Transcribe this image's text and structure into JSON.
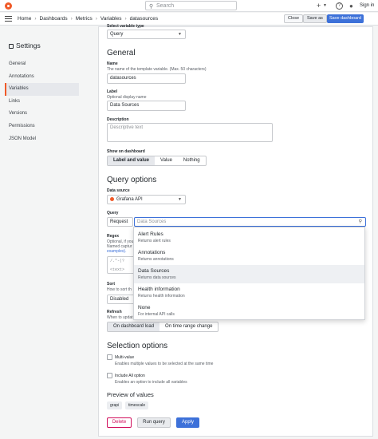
{
  "topbar": {
    "search_placeholder": "Search",
    "sign_in": "Sign in"
  },
  "breadcrumbs": [
    "Home",
    "Dashboards",
    "Metrics",
    "Variables",
    "datasources"
  ],
  "toolbar": {
    "close": "Close",
    "save_as": "Save as",
    "save_dashboard": "Save dashboard"
  },
  "sidebar": {
    "title": "Settings",
    "items": [
      "General",
      "Annotations",
      "Variables",
      "Links",
      "Versions",
      "Permissions",
      "JSON Model"
    ],
    "active": "Variables"
  },
  "form": {
    "cut_label": "Select variable type",
    "variable_type": "Query",
    "general_heading": "General",
    "name_label": "Name",
    "name_desc": "The name of the template variable. (Max. 50 characters)",
    "name_value": "datasources",
    "label_label": "Label",
    "label_desc": "Optional display name",
    "label_value": "Data Sources",
    "description_label": "Description",
    "description_placeholder": "Descriptive text",
    "show_label": "Show on dashboard",
    "show_options": [
      "Label and value",
      "Value",
      "Nothing"
    ],
    "query_options_heading": "Query options",
    "datasource_label": "Data source",
    "datasource_value": "Grafana API",
    "query_label": "Query",
    "query_type": "Request",
    "query_placeholder": "Data Sources",
    "regex_label": "Regex",
    "regex_desc1": "Optional, if you",
    "regex_desc2": "Named captur",
    "regex_link": "examples).",
    "regex_placeholder": "/.*-(?<text>",
    "sort_label": "Sort",
    "sort_desc": "How to sort th",
    "sort_value": "Disabled",
    "refresh_label": "Refresh",
    "refresh_desc": "When to updat",
    "refresh_options": [
      "On dashboard load",
      "On time range change"
    ],
    "selection_heading": "Selection options",
    "multi_label": "Multi-value",
    "multi_desc": "Enables multiple values to be selected at the same time",
    "includeall_label": "Include All option",
    "includeall_desc": "Enables an option to include all variables",
    "preview_heading": "Preview of values",
    "preview_values": [
      "grapi",
      "timescale"
    ],
    "delete": "Delete",
    "run_query": "Run query",
    "apply": "Apply"
  },
  "dropdown": [
    {
      "title": "Alert Rules",
      "desc": "Returns alert rules"
    },
    {
      "title": "Annotations",
      "desc": "Returns annotations"
    },
    {
      "title": "Data Sources",
      "desc": "Returns data sources"
    },
    {
      "title": "Health information",
      "desc": "Returns health information"
    },
    {
      "title": "None",
      "desc": "For internal API calls"
    }
  ],
  "colors": {
    "accent": "#f05a28",
    "primary": "#3d71d9",
    "danger": "#d10e5c"
  }
}
